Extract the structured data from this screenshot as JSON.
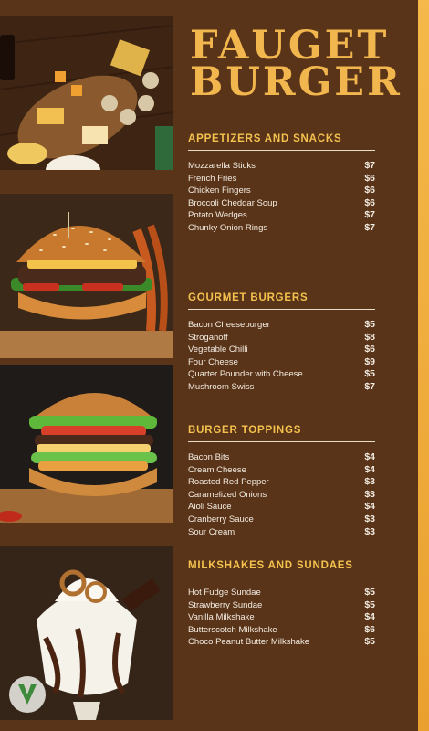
{
  "title": {
    "line1": "FAUGET",
    "line2": "BURGER"
  },
  "sections": [
    {
      "title": "APPETIZERS AND SNACKS",
      "items": [
        {
          "name": "Mozzarella Sticks",
          "price": "$7"
        },
        {
          "name": "French Fries",
          "price": "$6"
        },
        {
          "name": "Chicken Fingers",
          "price": "$6"
        },
        {
          "name": "Broccoli Cheddar Soup",
          "price": "$6"
        },
        {
          "name": "Potato Wedges",
          "price": "$7"
        },
        {
          "name": "Chunky Onion Rings",
          "price": "$7"
        }
      ]
    },
    {
      "title": "GOURMET BURGERS",
      "items": [
        {
          "name": "Bacon Cheeseburger",
          "price": "$5"
        },
        {
          "name": "Stroganoff",
          "price": "$8"
        },
        {
          "name": "Vegetable Chilli",
          "price": "$6"
        },
        {
          "name": "Four Cheese",
          "price": "$9"
        },
        {
          "name": "Quarter Pounder with Cheese",
          "price": "$5"
        },
        {
          "name": "Mushroom Swiss",
          "price": "$7"
        }
      ]
    },
    {
      "title": "BURGER TOPPINGS",
      "items": [
        {
          "name": "Bacon Bits",
          "price": "$4"
        },
        {
          "name": "Cream Cheese",
          "price": "$4"
        },
        {
          "name": "Roasted Red Pepper",
          "price": "$3"
        },
        {
          "name": "Caramelized Onions",
          "price": "$3"
        },
        {
          "name": "Aioli Sauce",
          "price": "$4"
        },
        {
          "name": "Cranberry Sauce",
          "price": "$3"
        },
        {
          "name": "Sour Cream",
          "price": "$3"
        }
      ]
    },
    {
      "title": "MILKSHAKES AND SUNDAES",
      "items": [
        {
          "name": "Hot Fudge Sundae",
          "price": "$5"
        },
        {
          "name": "Strawberry Sundae",
          "price": "$5"
        },
        {
          "name": "Vanilla Milkshake",
          "price": "$4"
        },
        {
          "name": "Butterscotch Milkshake",
          "price": "$6"
        },
        {
          "name": "Choco Peanut Butter Milkshake",
          "price": "$5"
        }
      ]
    }
  ],
  "colors": {
    "background": "#5a3418",
    "accent": "#f2b64e",
    "text": "#f3ece2"
  }
}
